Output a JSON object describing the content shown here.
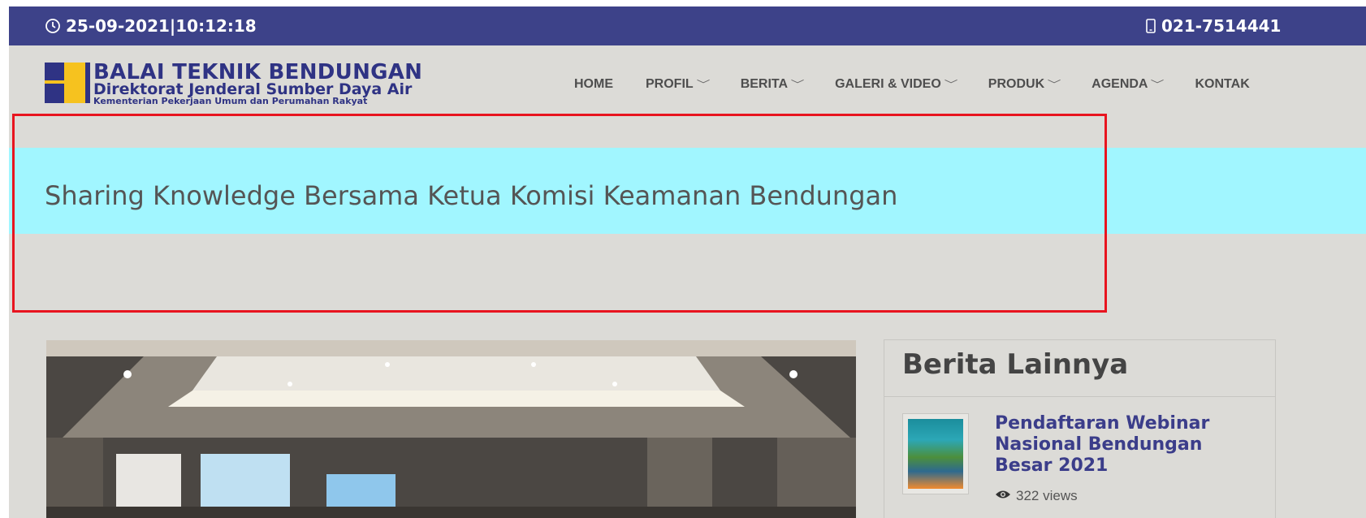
{
  "topbar": {
    "datetime": "25-09-2021|10:12:18",
    "phone": "021-7514441"
  },
  "logo": {
    "line1": "BALAI TEKNIK BENDUNGAN",
    "line2": "Direktorat Jenderal Sumber Daya Air",
    "line3": "Kementerian Pekerjaan Umum dan Perumahan Rakyat"
  },
  "nav": {
    "items": [
      {
        "label": "HOME",
        "dropdown": false
      },
      {
        "label": "PROFIL",
        "dropdown": true
      },
      {
        "label": "BERITA",
        "dropdown": true
      },
      {
        "label": "GALERI & VIDEO",
        "dropdown": true
      },
      {
        "label": "PRODUK",
        "dropdown": true
      },
      {
        "label": "AGENDA",
        "dropdown": true
      },
      {
        "label": "KONTAK",
        "dropdown": false
      }
    ],
    "chevron": "﹀"
  },
  "banner": {
    "title": "Sharing Knowledge Bersama Ketua Komisi Keamanan Bendungan"
  },
  "sidebar": {
    "title": "Berita Lainnya",
    "items": [
      {
        "title": "Pendaftaran Webinar Nasional Bendungan Besar 2021",
        "views": "322 views"
      }
    ]
  },
  "colors": {
    "topbar": "#3d4289",
    "banner": "#a1f6ff",
    "page_bg": "#dcdbd7",
    "highlight": "#e8141f",
    "link": "#3b3d8a"
  },
  "icons": [
    "clock-icon",
    "phone-icon",
    "chevron-down-icon",
    "eye-icon"
  ]
}
